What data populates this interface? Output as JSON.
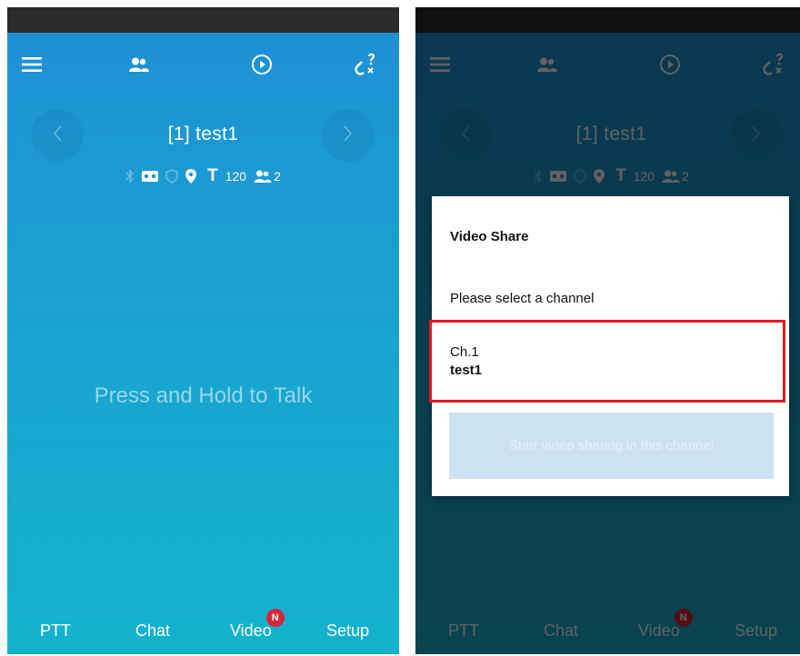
{
  "toolbar": {
    "menu_icon": "hamburger-menu-icon",
    "contacts_icon": "contacts-icon",
    "playback_icon": "play-circle-icon",
    "link_status_icon": "broken-link-question-icon"
  },
  "channel": {
    "title": "[1] test1",
    "prev_icon": "chevron-left-icon",
    "next_icon": "chevron-right-icon"
  },
  "status": {
    "timer": "120",
    "members": "2"
  },
  "ptt": {
    "prompt": "Press and Hold to Talk"
  },
  "bottom_nav": {
    "ptt": "PTT",
    "chat": "Chat",
    "video": "Video",
    "video_badge": "N",
    "setup": "Setup"
  },
  "dialog": {
    "title": "Video Share",
    "subtitle": "Please select a channel",
    "channels": [
      {
        "channel_label": "Ch.1",
        "name": "test1"
      }
    ],
    "start_button": "Start video sharing in this channel"
  },
  "colors": {
    "gradient_top": "#1f8fd6",
    "gradient_bottom": "#14b2cd",
    "badge": "#d6263a",
    "highlight_border": "#e0191f",
    "disabled_button": "#cce2f1"
  }
}
